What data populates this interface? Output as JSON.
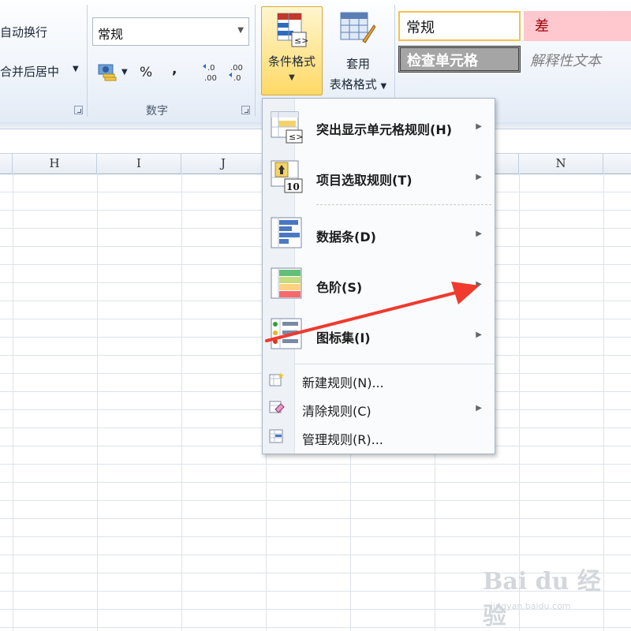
{
  "ribbon": {
    "alignment": {
      "wrap_text": "自动换行",
      "merge_center": "合并后居中"
    },
    "number": {
      "format_value": "常规",
      "percent": "%",
      "comma": ",",
      "group_label": "数字"
    },
    "conditional_format": {
      "label": "条件格式"
    },
    "format_as_table": {
      "line1": "套用",
      "line2": "表格格式"
    },
    "styles": {
      "normal": "常规",
      "bad": "差",
      "check_cell": "检查单元格",
      "explanatory": "解释性文本"
    }
  },
  "sheet": {
    "columns": [
      "H",
      "I",
      "J",
      "N"
    ]
  },
  "menu": {
    "items": [
      {
        "label": "突出显示单元格规则(H)"
      },
      {
        "label": "项目选取规则(T)"
      },
      {
        "label": "数据条(D)"
      },
      {
        "label": "色阶(S)"
      },
      {
        "label": "图标集(I)"
      },
      {
        "label": "新建规则(N)..."
      },
      {
        "label": "清除规则(C)"
      },
      {
        "label": "管理规则(R)..."
      }
    ]
  },
  "annotation": {
    "arrow_color": "#f03a2e"
  },
  "watermark": {
    "brand": "Bai du 经验",
    "url": "jingyan.baidu.com"
  }
}
